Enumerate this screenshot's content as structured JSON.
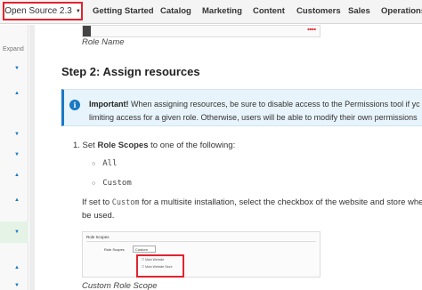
{
  "topnav": {
    "version_label": "Open Source 2.3",
    "items": [
      "Getting Started",
      "Catalog",
      "Marketing",
      "Content",
      "Customers",
      "Sales",
      "Operations"
    ]
  },
  "sidebar": {
    "expand_label": "Expand"
  },
  "content": {
    "role_name_caption": "Role Name",
    "heading": "Step 2: Assign resources",
    "note": {
      "important_label": "Important!",
      "line1": "When assigning resources, be sure to disable access to the Permissions tool if yc",
      "line2": "limiting access for a given role. Otherwise, users will be able to modify their own permissions"
    },
    "step1": {
      "prefix": "1. Set ",
      "bold": "Role Scopes",
      "suffix": " to one of the following:"
    },
    "options": [
      "All",
      "Custom"
    ],
    "multisite": {
      "prefix": "If set to ",
      "code": "Custom",
      "suffix": " for a multisite installation, select the checkbox of the website and store where",
      "line2": "be used."
    },
    "screenshot": {
      "title": "Role Scopes",
      "field_label": "Role Scopes",
      "select_value": "Custom",
      "checkboxes": [
        "Main Website",
        "Main Website Store"
      ]
    },
    "custom_scope_caption": "Custom Role Scope"
  }
}
